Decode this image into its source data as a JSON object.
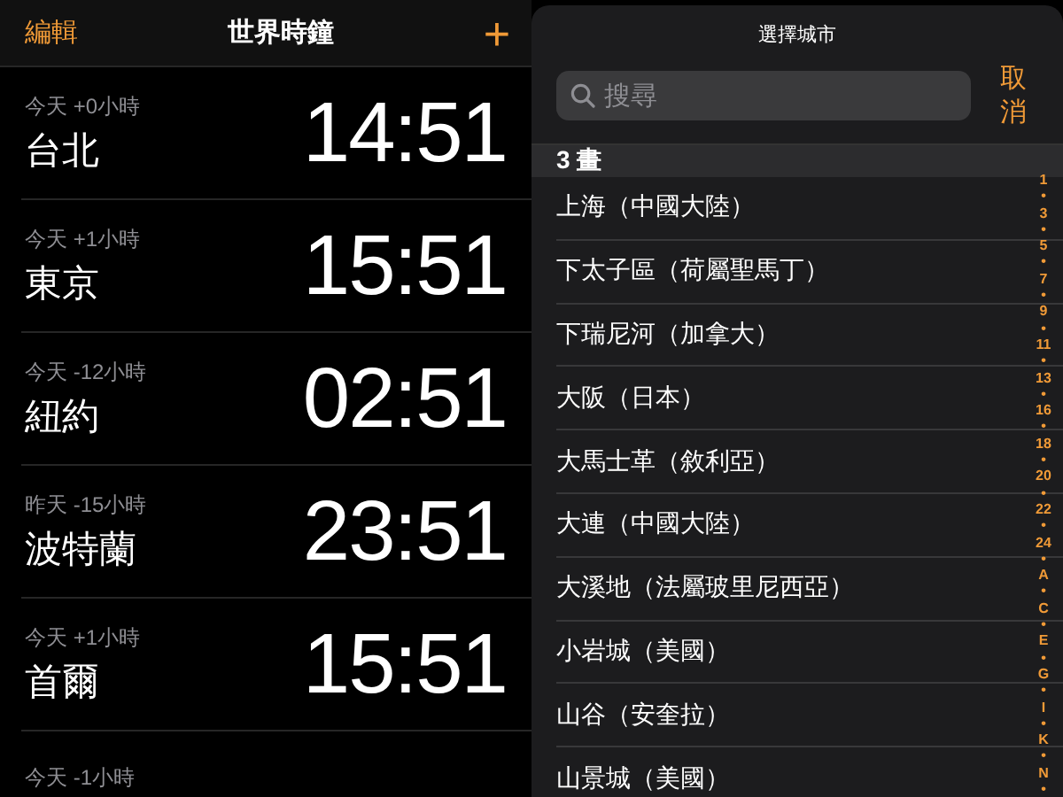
{
  "clock": {
    "edit": "編輯",
    "title": "世界時鐘",
    "add": "+",
    "cities": [
      {
        "offset": "今天 +0小時",
        "name": "台北",
        "time": "14:51"
      },
      {
        "offset": "今天 +1小時",
        "name": "東京",
        "time": "15:51"
      },
      {
        "offset": "今天 -12小時",
        "name": "紐約",
        "time": "02:51"
      },
      {
        "offset": "昨天 -15小時",
        "name": "波特蘭",
        "time": "23:51"
      },
      {
        "offset": "今天 +1小時",
        "name": "首爾",
        "time": "15:51"
      },
      {
        "offset": "今天 -1小時"
      }
    ]
  },
  "picker": {
    "title": "選擇城市",
    "search": {
      "placeholder": "搜尋"
    },
    "cancel": "取消",
    "section": "3 畫",
    "cities": [
      "上海（中國大陸）",
      "下太子區（荷屬聖馬丁）",
      "下瑞尼河（加拿大）",
      "大阪（日本）",
      "大馬士革（敘利亞）",
      "大連（中國大陸）",
      "大溪地（法屬玻里尼西亞）",
      "小岩城（美國）",
      "山谷（安奎拉）",
      "山景城（美國）"
    ],
    "index": [
      "1",
      "•",
      "3",
      "•",
      "5",
      "•",
      "7",
      "•",
      "9",
      "•",
      "11",
      "•",
      "13",
      "•",
      "16",
      "•",
      "18",
      "•",
      "20",
      "•",
      "22",
      "•",
      "24",
      "•",
      "A",
      "•",
      "C",
      "•",
      "E",
      "•",
      "G",
      "•",
      "I",
      "•",
      "K",
      "•",
      "N",
      "•"
    ]
  }
}
